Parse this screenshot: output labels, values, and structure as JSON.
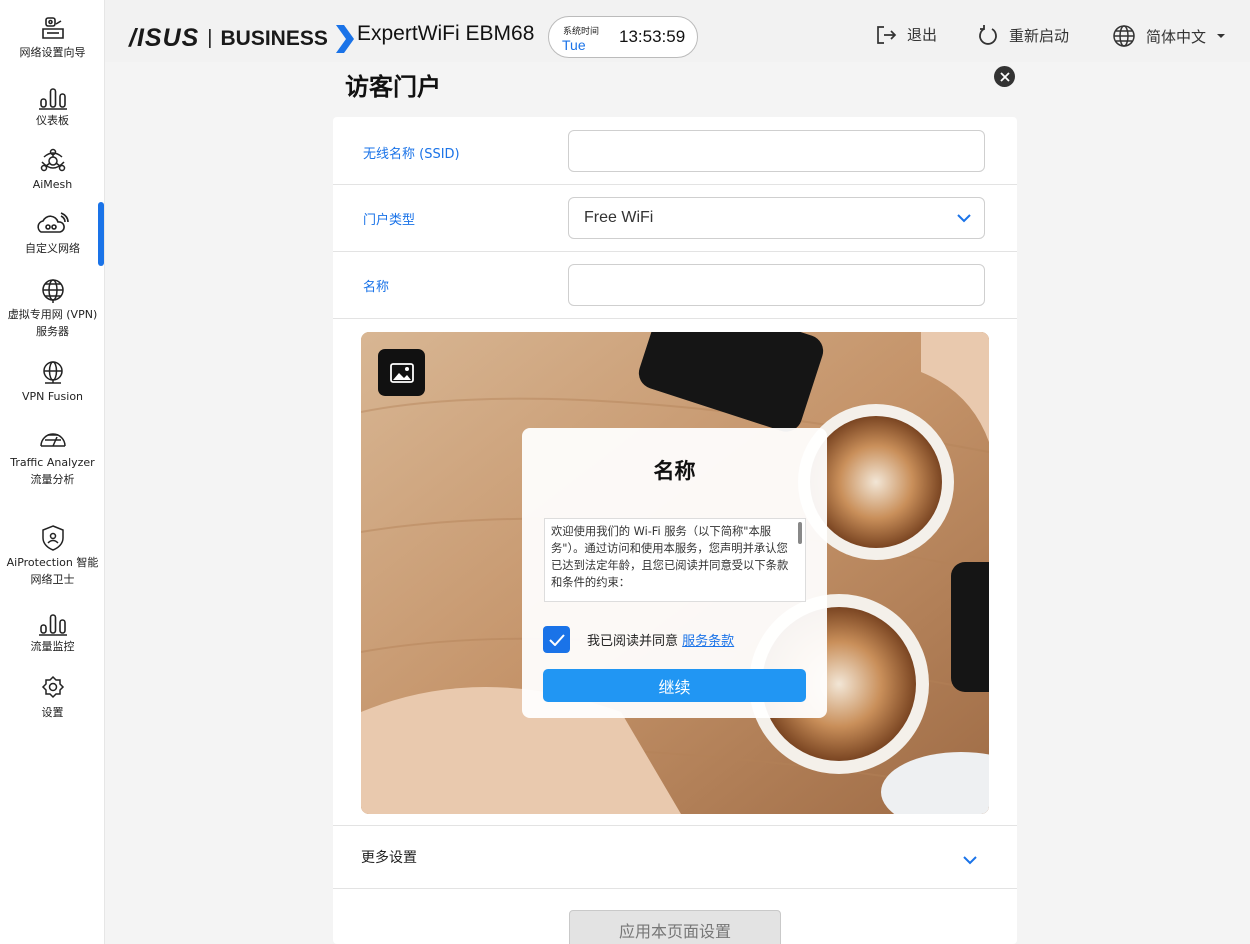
{
  "sidebar": {
    "items": [
      {
        "label": "网络设置向导",
        "icon": "network-wizard-icon"
      },
      {
        "label": "仪表板",
        "icon": "dashboard-icon"
      },
      {
        "label": "AiMesh",
        "icon": "aimesh-icon"
      },
      {
        "label": "自定义网络",
        "icon": "custom-network-icon"
      },
      {
        "label": "虚拟专用网 (VPN) 服务器",
        "icon": "vpn-server-icon"
      },
      {
        "label": "VPN Fusion",
        "icon": "vpn-fusion-icon"
      },
      {
        "label": "Traffic Analyzer 流量分析",
        "icon": "traffic-analyzer-icon"
      },
      {
        "label": "AiProtection 智能网络卫士",
        "icon": "aiprotection-icon"
      },
      {
        "label": "流量监控",
        "icon": "traffic-monitor-icon"
      },
      {
        "label": "设置",
        "icon": "settings-icon"
      }
    ],
    "active": "自定义网络"
  },
  "header": {
    "logo_brand": "/ISUS",
    "logo_separator": "|",
    "logo_business": "BUSINESS",
    "model": "ExpertWiFi EBM68",
    "clock_label": "系统时间",
    "clock_day": "Tue",
    "clock_time": "13:53:59",
    "logout_label": "退出",
    "reboot_label": "重新启动",
    "language_label": "简体中文"
  },
  "panel": {
    "title": "访客门户",
    "ssid_label": "无线名称 (SSID)",
    "ssid_value": "",
    "portal_type_label": "门户类型",
    "portal_type_value": "Free WiFi",
    "name_label": "名称",
    "name_value": "",
    "more_settings": "更多设置",
    "apply_label": "应用本页面设置"
  },
  "preview": {
    "title": "名称",
    "terms_text": "欢迎使用我们的 Wi-Fi 服务（以下简称\"本服务\"）。通过访问和使用本服务，您声明并承认您已达到法定年龄，且您已阅读并同意受以下条款和条件的约束：",
    "agree_text": "我已阅读并同意",
    "agree_link": "服务条款",
    "continue_label": "继续",
    "checked": true
  },
  "colors": {
    "accent": "#1a73e8",
    "button": "#2196f3"
  }
}
